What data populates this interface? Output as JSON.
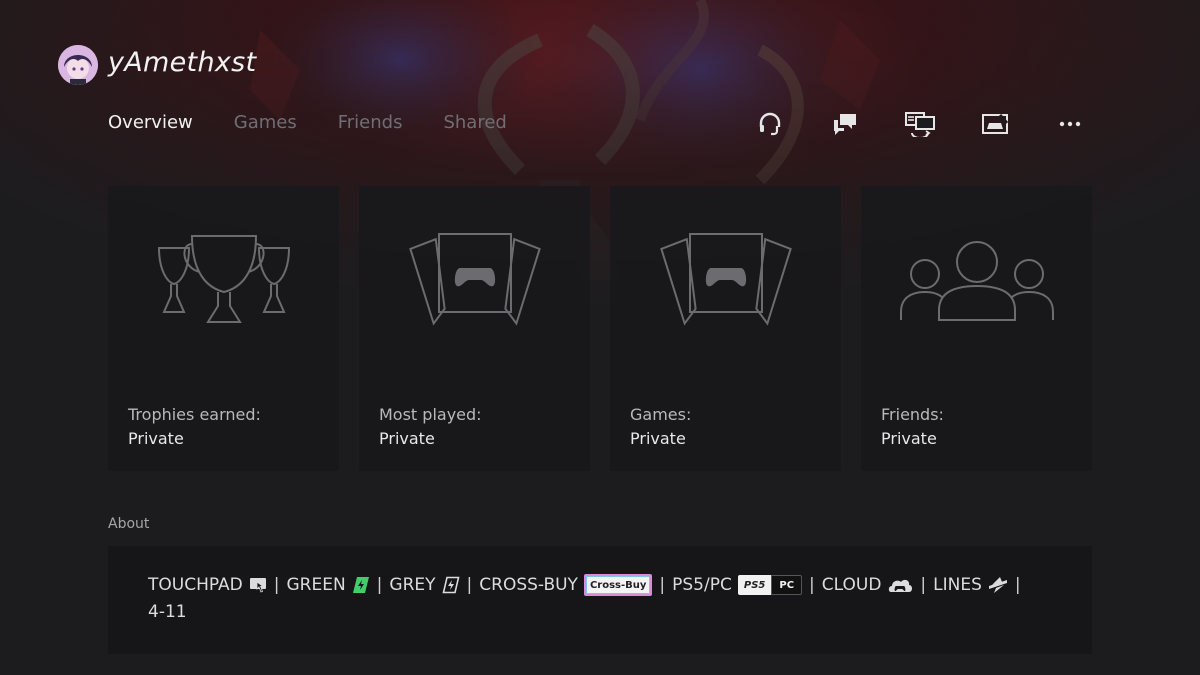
{
  "profile": {
    "username": "yAmethxst"
  },
  "tabs": [
    {
      "label": "Overview",
      "active": true
    },
    {
      "label": "Games",
      "active": false
    },
    {
      "label": "Friends",
      "active": false
    },
    {
      "label": "Shared",
      "active": false
    }
  ],
  "actions": [
    {
      "icon": "headset-icon"
    },
    {
      "icon": "chat-bubbles-icon"
    },
    {
      "icon": "share-screen-icon"
    },
    {
      "icon": "remote-play-icon"
    },
    {
      "icon": "more-options-icon"
    }
  ],
  "cards": [
    {
      "icon": "trophies-icon",
      "label": "Trophies earned:",
      "value": "Private"
    },
    {
      "icon": "game-cards-icon",
      "label": "Most played:",
      "value": "Private"
    },
    {
      "icon": "game-cards-icon",
      "label": "Games:",
      "value": "Private"
    },
    {
      "icon": "friends-icon",
      "label": "Friends:",
      "value": "Private"
    }
  ],
  "about": {
    "heading": "About",
    "items": [
      {
        "text": "TOUCHPAD",
        "icon": "touchpad-icon"
      },
      {
        "text": "GREEN",
        "icon": "green-lightning-icon",
        "color": "#3ecf6a"
      },
      {
        "text": "GREY",
        "icon": "grey-lightning-icon"
      },
      {
        "text": "CROSS-BUY",
        "badge": "Cross-Buy"
      },
      {
        "text": "PS5/PC",
        "badge_left": "PS5",
        "badge_right": "PC"
      },
      {
        "text": "CLOUD",
        "icon": "cloud-icon"
      },
      {
        "text": "LINES",
        "icon": "lines-icon"
      }
    ],
    "line2": "4-11"
  },
  "colors": {
    "background": "#1c1c1e",
    "card": "#18181a",
    "tab_inactive": "#6f6f73",
    "tab_active": "#f0f0f0",
    "accent_green": "#3ecf6a"
  }
}
